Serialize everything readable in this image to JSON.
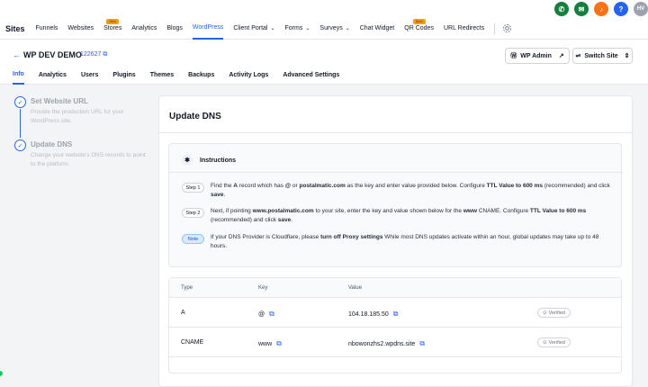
{
  "topbar": {
    "icons": [
      {
        "name": "phone-icon",
        "glyph": "✆",
        "color": "#15803d"
      },
      {
        "name": "megaphone-icon",
        "glyph": "✉",
        "color": "#15803d"
      },
      {
        "name": "bell-icon",
        "glyph": "♪",
        "color": "#f97316"
      },
      {
        "name": "help-icon",
        "glyph": "?",
        "color": "#2563eb"
      }
    ],
    "avatar": "HV",
    "avatar_color": "#9ca3af"
  },
  "nav": {
    "sites": "Sites",
    "items": [
      {
        "label": "Funnels"
      },
      {
        "label": "Websites"
      },
      {
        "label": "Stores",
        "badge": "New"
      },
      {
        "label": "Analytics"
      },
      {
        "label": "Blogs"
      },
      {
        "label": "WordPress",
        "active": true
      },
      {
        "label": "Client Portal",
        "dropdown": true
      },
      {
        "label": "Forms",
        "dropdown": true
      },
      {
        "label": "Surveys",
        "dropdown": true
      },
      {
        "label": "Chat Widget"
      },
      {
        "label": "QR Codes",
        "badge": "New"
      },
      {
        "label": "URL Redirects"
      }
    ]
  },
  "page": {
    "back_icon": "←",
    "site_title": "WP DEV DEMO",
    "site_id": "122627",
    "wp_admin": "WP Admin",
    "switch_site": "Switch Site"
  },
  "tabs": [
    "Info",
    "Analytics",
    "Users",
    "Plugins",
    "Themes",
    "Backups",
    "Activity Logs",
    "Advanced Settings"
  ],
  "steps": [
    {
      "title": "Set Website URL",
      "desc": "Provide the production URL for your WordPress site."
    },
    {
      "title": "Update DNS",
      "desc": "Change your website's DNS records to point to the platform."
    }
  ],
  "card": {
    "title": "Update DNS",
    "instructions_title": "Instructions",
    "step1_label": "Step 1",
    "step2_label": "Step 2",
    "note_label": "Note",
    "step1_a": "Find the ",
    "step1_b": "A",
    "step1_c": " record which has ",
    "step1_d": "@",
    "step1_e": " or ",
    "step1_f": "postalmatic.com",
    "step1_g": " as the key and enter value provided below. Configure ",
    "step1_h": "TTL Value to 600 ms",
    "step1_i": " (recommended) and click ",
    "step1_j": "save",
    "step1_k": ".",
    "step2_a": "Next, if pointing ",
    "step2_b": "www.postalmatic.com",
    "step2_c": " to your site, enter the key and value shown below for the ",
    "step2_d": "www",
    "step2_e": " CNAME. Configure ",
    "step2_f": "TTL Value to 600 ms",
    "step2_g": " (recommended) and click ",
    "step2_h": "save",
    "step2_i": ".",
    "note_a": "If your DNS Provider is Cloudflare, please ",
    "note_b": "turn off Proxy settings",
    "note_c": " While most DNS updates activate within an hour, global updates may take up to 48 hours."
  },
  "table": {
    "headers": [
      "Type",
      "Key",
      "Value"
    ],
    "rows": [
      {
        "type": "A",
        "key": "@",
        "value": "104.18.185.50",
        "status": "Verified"
      },
      {
        "type": "CNAME",
        "key": "www",
        "value": "nbowonzhs2.wpdns.site",
        "status": "Verified"
      }
    ]
  }
}
